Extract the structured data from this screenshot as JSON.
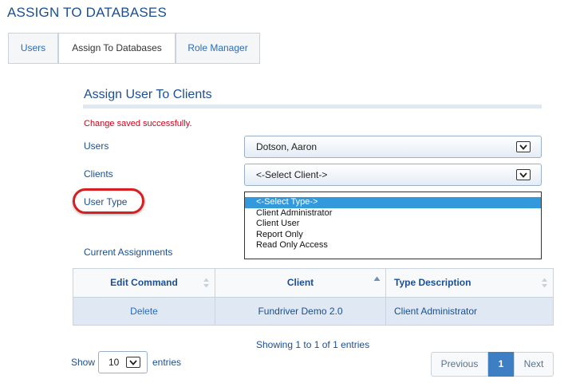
{
  "page": {
    "title": "ASSIGN TO DATABASES"
  },
  "tabs": [
    {
      "label": "Users"
    },
    {
      "label": "Assign To Databases"
    },
    {
      "label": "Role Manager"
    }
  ],
  "section": {
    "title": "Assign User To Clients",
    "message": "Change saved successfully.",
    "message_color": "#d0021b"
  },
  "form": {
    "users_label": "Users",
    "users_value": "Dotson, Aaron",
    "clients_label": "Clients",
    "clients_value": "<-Select Client->",
    "user_type_label": "User Type",
    "user_type_options": [
      "<-Select Type->",
      "Client Administrator",
      "Client User",
      "Report Only",
      "Read Only Access"
    ],
    "current_assignments_label": "Current Assignments"
  },
  "table": {
    "headers": [
      "Edit Command",
      "Client",
      "Type Description"
    ],
    "rows": [
      {
        "edit": "Delete",
        "client": "Fundriver Demo 2.0",
        "type": "Client Administrator"
      }
    ],
    "info": "Showing 1 to 1 of 1 entries",
    "show_label": "Show",
    "page_length": "10",
    "entries_label": "entries"
  },
  "pagination": {
    "previous": "Previous",
    "current": "1",
    "next": "Next"
  },
  "colors": {
    "accent": "#1b4f93",
    "highlight": "#d81e1e",
    "selected_option": "#3399dd",
    "active_page": "#3d7fc2"
  }
}
